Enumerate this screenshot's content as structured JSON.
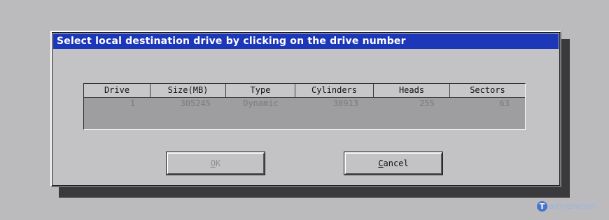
{
  "dialog": {
    "title": "Select local destination drive by clicking on the drive number"
  },
  "table": {
    "columns": [
      "Drive",
      "Size(MB)",
      "Type",
      "Cylinders",
      "Heads",
      "Sectors"
    ],
    "rows": [
      [
        "1",
        "305245",
        "Dynamic",
        "38913",
        "255",
        "63"
      ]
    ]
  },
  "buttons": {
    "ok": {
      "mnemonic": "O",
      "rest": "K",
      "enabled": false
    },
    "cancel": {
      "mnemonic": "C",
      "rest": "ancel",
      "enabled": true
    }
  },
  "watermark": {
    "logo_letter": "T",
    "text": "aimienmph"
  },
  "colors": {
    "title_bar": "#1c38b8",
    "dialog_bg": "#c3c3c5",
    "desktop_bg": "#bbbbbd",
    "table_bg": "#9e9ea0"
  }
}
